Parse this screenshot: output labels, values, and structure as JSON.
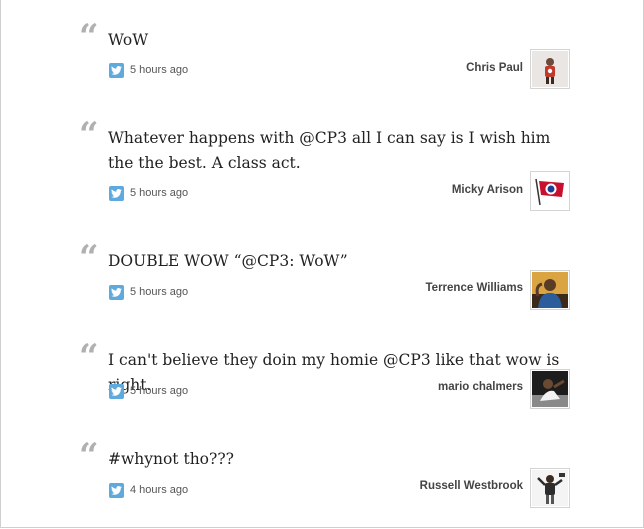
{
  "tweets": [
    {
      "text": "WoW",
      "time": "5 hours ago",
      "author": "Chris Paul",
      "avatar_icon": "chris-paul-photo"
    },
    {
      "text": "Whatever happens with @CP3 all I can say is I wish him the the best. A class act.",
      "time": "5 hours ago",
      "author": "Micky Arison",
      "avatar_icon": "carnival-flag-logo"
    },
    {
      "text": "DOUBLE WOW “@CP3: WoW”",
      "time": "5 hours ago",
      "author": "Terrence Williams",
      "avatar_icon": "terrence-williams-photo"
    },
    {
      "text": "I can't believe they doin my homie @CP3 like that wow is right.",
      "time": "5 hours ago",
      "author": "mario chalmers",
      "avatar_icon": "mario-chalmers-photo"
    },
    {
      "text": "#whynot tho???",
      "time": "4 hours ago",
      "author": "Russell Westbrook",
      "avatar_icon": "russell-westbrook-photo"
    }
  ],
  "quote_glyph": "“",
  "colors": {
    "quote": "#b0b0b0",
    "text": "#222222",
    "twitter_icon": "#5ea9dd",
    "author": "#444444",
    "time": "#555555"
  }
}
